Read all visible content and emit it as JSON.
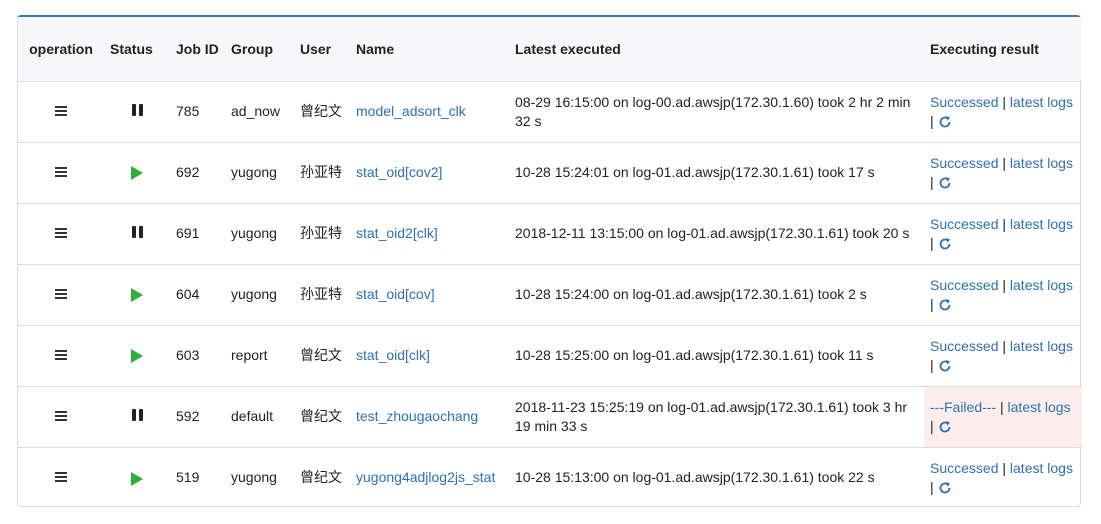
{
  "headers": {
    "operation": "operation",
    "status": "Status",
    "job_id": "Job ID",
    "group": "Group",
    "user": "User",
    "name": "Name",
    "latest": "Latest executed",
    "result": "Executing result"
  },
  "colors": {
    "accent": "#337ab7",
    "link": "#2f6fb3",
    "play": "#2eaf3c",
    "failed": "#e04848",
    "failed_bg": "#fdeeee"
  },
  "rows": [
    {
      "status": "paused",
      "job_id": "785",
      "group": "ad_now",
      "user": "曾纪文",
      "name": "model_adsort_clk",
      "latest": "08-29 16:15:00 on log-00.ad.awsjp(172.30.1.60) took 2 hr 2 min 32 s",
      "result": "Successed",
      "logs": "latest logs",
      "sep": "|"
    },
    {
      "status": "running",
      "job_id": "692",
      "group": "yugong",
      "user": "孙亚特",
      "name": "stat_oid[cov2]",
      "latest": "10-28 15:24:01 on log-01.ad.awsjp(172.30.1.61) took 17 s",
      "result": "Successed",
      "logs": "latest logs",
      "sep": "|"
    },
    {
      "status": "paused",
      "job_id": "691",
      "group": "yugong",
      "user": "孙亚特",
      "name": "stat_oid2[clk]",
      "latest": "2018-12-11 13:15:00 on log-01.ad.awsjp(172.30.1.61) took 20 s",
      "result": "Successed",
      "logs": "latest logs",
      "sep": "|"
    },
    {
      "status": "running",
      "job_id": "604",
      "group": "yugong",
      "user": "孙亚特",
      "name": "stat_oid[cov]",
      "latest": "10-28 15:24:00 on log-01.ad.awsjp(172.30.1.61) took 2 s",
      "result": "Successed",
      "logs": "latest logs",
      "sep": "|"
    },
    {
      "status": "running",
      "job_id": "603",
      "group": "report",
      "user": "曾纪文",
      "name": "stat_oid[clk]",
      "latest": "10-28 15:25:00 on log-01.ad.awsjp(172.30.1.61) took 11 s",
      "result": "Successed",
      "logs": "latest logs",
      "sep": "|"
    },
    {
      "status": "paused",
      "job_id": "592",
      "group": "default",
      "user": "曾纪文",
      "name": "test_zhougaochang",
      "latest": "2018-11-23 15:25:19 on log-01.ad.awsjp(172.30.1.61) took 3 hr 19 min 33 s",
      "result": "---Failed---",
      "logs": "latest logs",
      "sep": "|",
      "failed": true
    },
    {
      "status": "running",
      "job_id": "519",
      "group": "yugong",
      "user": "曾纪文",
      "name": "yugong4adjlog2js_stat",
      "latest": "10-28 15:13:00 on log-01.ad.awsjp(172.30.1.61) took 22 s",
      "result": "Successed",
      "logs": "latest logs",
      "sep": "|"
    }
  ]
}
